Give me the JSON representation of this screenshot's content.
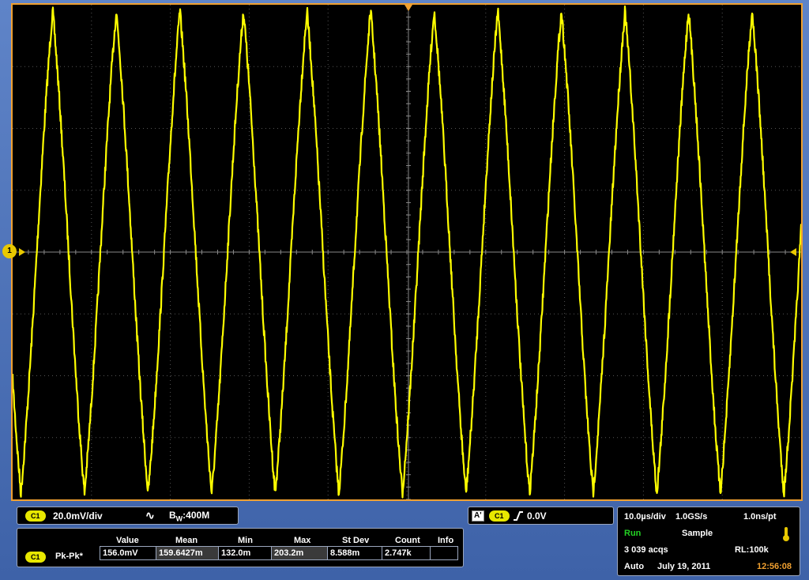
{
  "channel": {
    "badge": "C1",
    "scale": "20.0mV/div",
    "coupling_icon": "ac-coupling-icon",
    "bw_label": "B",
    "bw_sub": "W",
    "bw_value": ":400M",
    "marker_label": "1"
  },
  "trigger": {
    "source_badge": "A'",
    "channel_badge": "C1",
    "slope_icon": "rising-edge-icon",
    "level": "0.0V"
  },
  "acquisition": {
    "timebase": "10.0µs/div",
    "sample_rate": "1.0GS/s",
    "resolution": "1.0ns/pt",
    "state": "Run",
    "mode": "Sample",
    "acqs": "3 039 acqs",
    "record_length": "RL:100k",
    "trigger_mode": "Auto",
    "date": "July 19, 2011",
    "time": "12:56:08",
    "thermometer_icon": "thermometer-icon"
  },
  "measurements": {
    "headers": [
      "Value",
      "Mean",
      "Min",
      "Max",
      "St Dev",
      "Count",
      "Info"
    ],
    "row": {
      "badge": "C1",
      "name": "Pk-Pk*",
      "value": "156.0mV",
      "mean": "159.6427m",
      "min": "132.0m",
      "max": "203.2m",
      "stdev": "8.588m",
      "count": "2.747k",
      "info": ""
    }
  },
  "colors": {
    "trace": "#ffff00",
    "accent": "#f0a030",
    "run": "#23d223",
    "frame": "#4a6fb4"
  },
  "chart_data": {
    "type": "line",
    "series": [
      {
        "cycles_on_screen": 12.4,
        "peak_to_peak_mV": 156.0
      }
    ],
    "grid": true,
    "divisions_x": 10,
    "divisions_y": 8
  }
}
